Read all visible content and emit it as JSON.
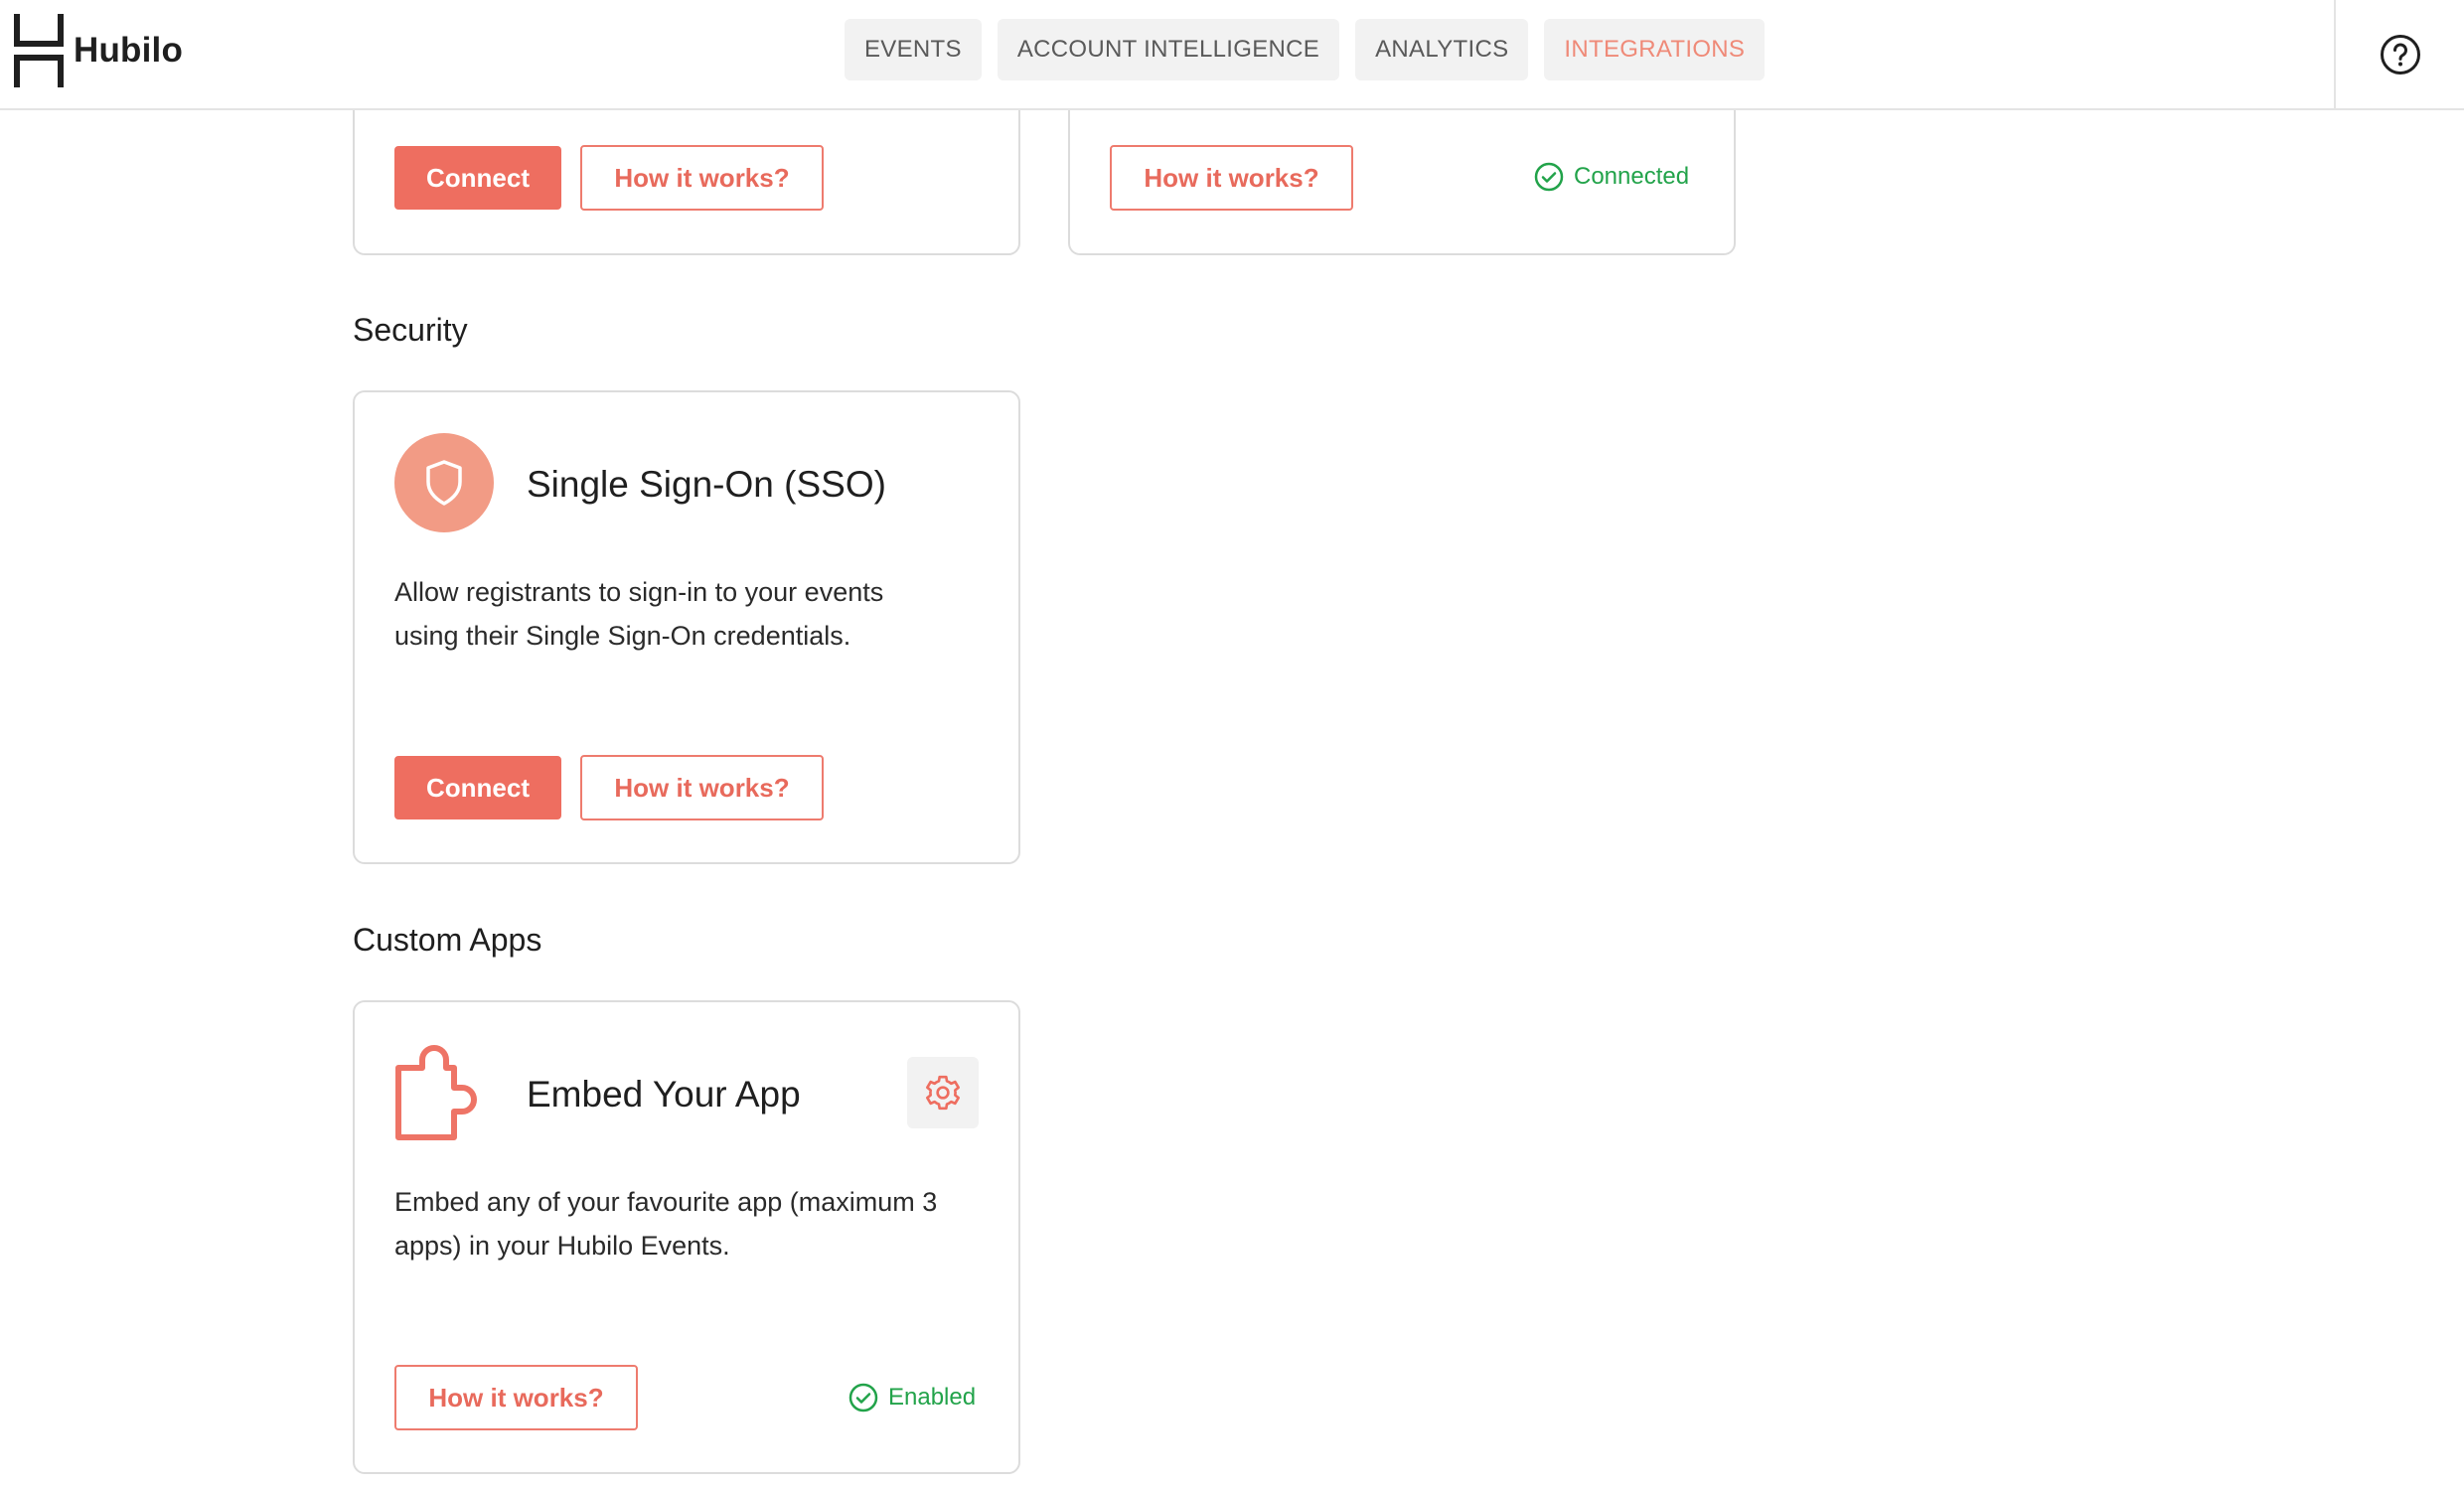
{
  "app": {
    "brand": "Hubilo"
  },
  "nav": {
    "items": [
      {
        "label": "EVENTS"
      },
      {
        "label": "ACCOUNT INTELLIGENCE"
      },
      {
        "label": "ANALYTICS"
      },
      {
        "label": "INTEGRATIONS",
        "active": true
      }
    ]
  },
  "top_cards": {
    "left": {
      "connect_label": "Connect",
      "how_label": "How it works?"
    },
    "right": {
      "how_label": "How it works?",
      "status": "Connected"
    }
  },
  "security": {
    "heading": "Security",
    "card": {
      "icon": "shield-icon",
      "title": "Single Sign-On (SSO)",
      "desc_line1": "Allow registrants to sign-in to your events",
      "desc_line2": "using their Single Sign-On credentials.",
      "connect_label": "Connect",
      "how_label": "How it works?"
    }
  },
  "custom_apps": {
    "heading": "Custom Apps",
    "card": {
      "icon": "puzzle-icon",
      "title": "Embed Your App",
      "desc_line1": "Embed any of your favourite app (maximum 3",
      "desc_line2": "apps) in your Hubilo Events.",
      "how_label": "How it works?",
      "status": "Enabled"
    }
  },
  "colors": {
    "accent": "#ee6e60",
    "success": "#22a34a",
    "icon_bg": "#f29b85",
    "nav_active": "#ef8a78"
  }
}
